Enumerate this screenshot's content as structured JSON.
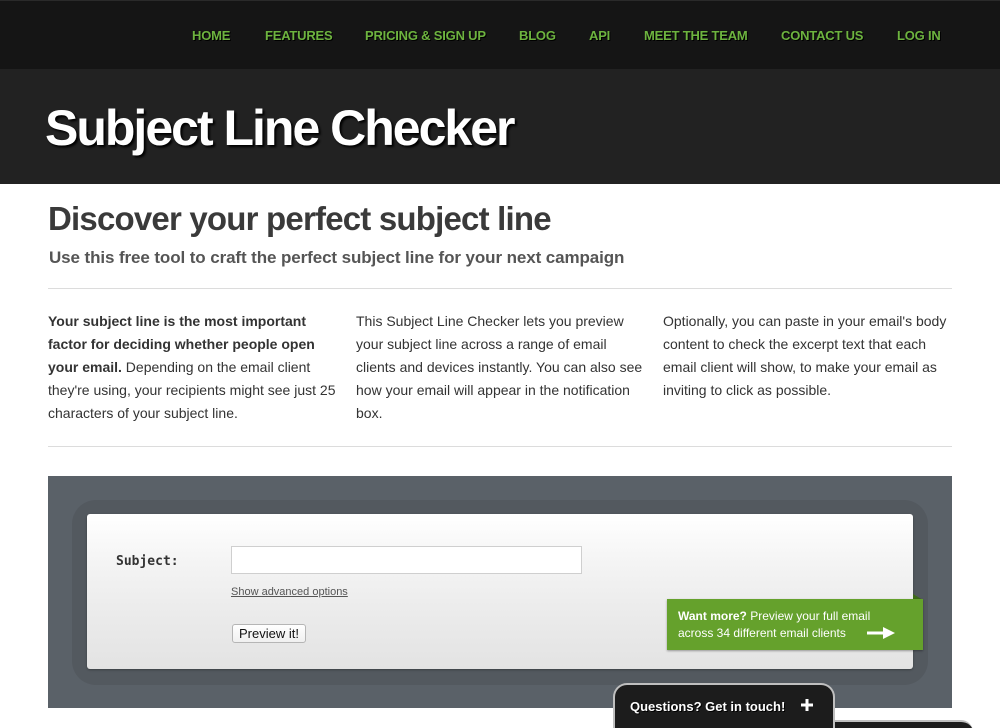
{
  "nav": {
    "items": [
      {
        "label": "HOME"
      },
      {
        "label": "FEATURES"
      },
      {
        "label": "PRICING & SIGN UP"
      },
      {
        "label": "BLOG"
      },
      {
        "label": "API"
      },
      {
        "label": "MEET THE TEAM"
      },
      {
        "label": "CONTACT US"
      },
      {
        "label": "LOG IN"
      }
    ]
  },
  "hero": {
    "title": "Subject Line Checker"
  },
  "main": {
    "title": "Discover your perfect subject line",
    "subtitle": "Use this free tool to craft the perfect subject line for your next campaign",
    "columns": [
      {
        "bold": "Your subject line is the most important factor for deciding whether people open your email.",
        "text": " Depending on the email client they're using, your recipients might see just 25 characters of your subject line."
      },
      {
        "text": "This Subject Line Checker lets you preview your subject line across a range of email clients and devices instantly. You can also see how your email will appear in the notification box."
      },
      {
        "text": "Optionally, you can paste in your email's body content to check the excerpt text that each email client will show, to make your email as inviting to click as possible."
      }
    ]
  },
  "tool": {
    "subject_label": "Subject:",
    "subject_value": "",
    "subject_placeholder": "",
    "advanced_link": "Show advanced options",
    "preview_button": "Preview it!"
  },
  "promo": {
    "bold": "Want more?",
    "line1": " Preview your full email",
    "line2": "across 34 different email clients",
    "icon": "arrow-right-icon"
  },
  "questions": {
    "label": "Questions? Get in touch!",
    "icon": "plus-icon"
  },
  "colors": {
    "nav_bg": "#151515",
    "nav_link": "#6db33f",
    "hero_bg": "#222222",
    "panel_bg": "#5a6168",
    "promo_green": "#65a12c"
  }
}
